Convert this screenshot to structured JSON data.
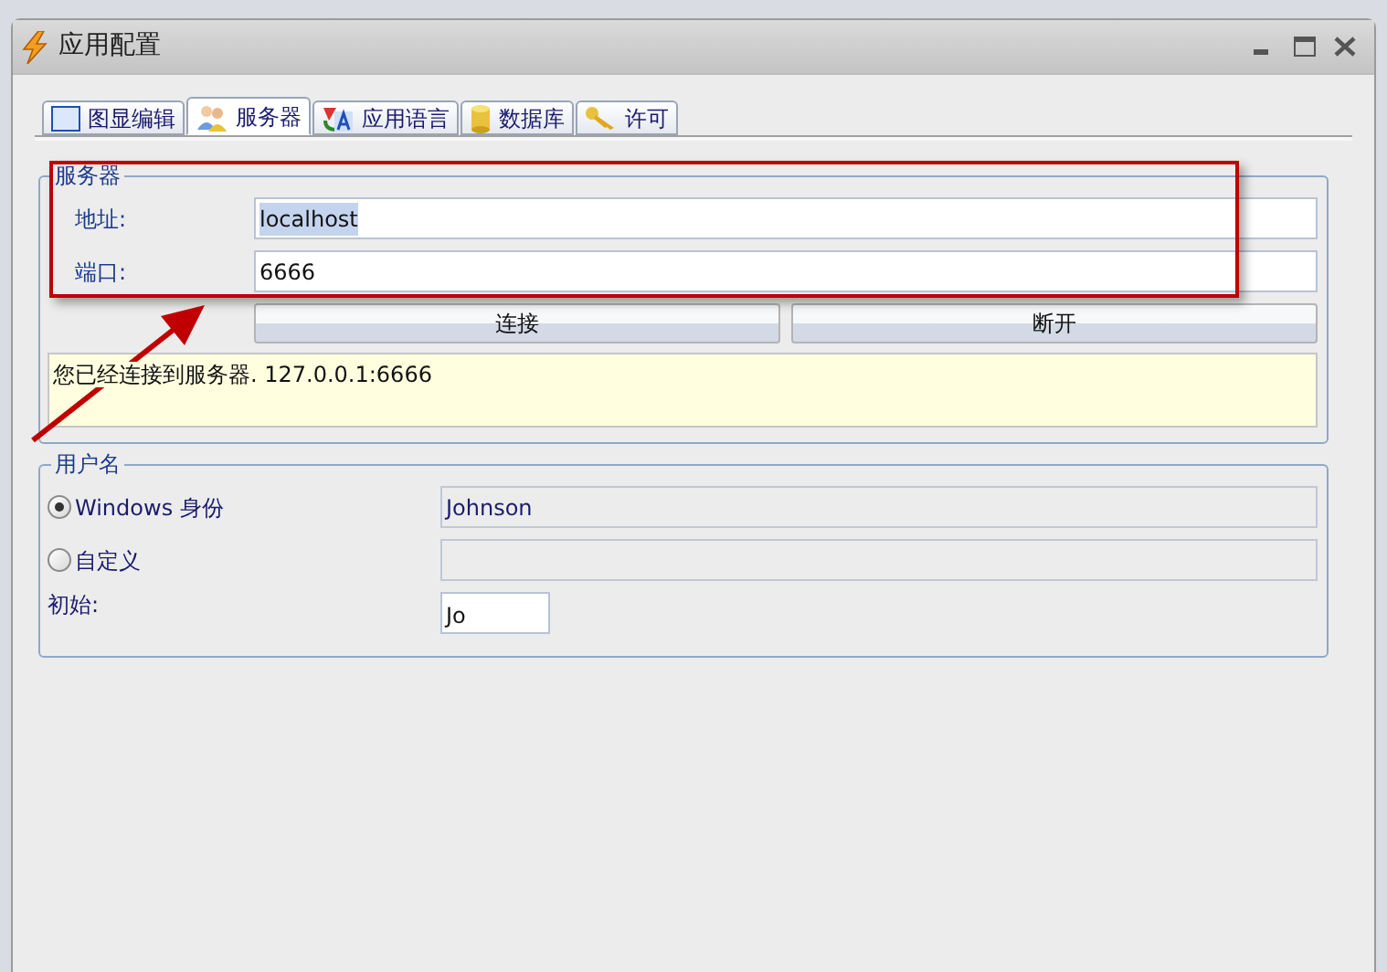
{
  "window": {
    "title": "应用配置"
  },
  "tabs": [
    {
      "label": "图显编辑",
      "selected": false,
      "kind": "frame"
    },
    {
      "label": "服务器",
      "selected": true,
      "kind": "users"
    },
    {
      "label": "应用语言",
      "selected": false,
      "kind": "language"
    },
    {
      "label": "数据库",
      "selected": false,
      "kind": "database"
    },
    {
      "label": "许可",
      "selected": false,
      "kind": "key"
    }
  ],
  "server": {
    "legend": "服务器",
    "fields": [
      {
        "label": "地址:",
        "value": "localhost",
        "highlighted": true
      },
      {
        "label": "端口:",
        "value": "6666",
        "highlighted": false
      }
    ],
    "buttons": [
      "连接",
      "断开"
    ],
    "message": "您已经连接到服务器. 127.0.0.1:6666"
  },
  "user": {
    "legend": "用户名",
    "options": [
      {
        "label": "Windows 身份",
        "selected": true,
        "value": "Johnson"
      },
      {
        "label": "自定义",
        "selected": false
      }
    ],
    "initial": {
      "label": "初始:",
      "value": "Jo"
    }
  },
  "annotation": {
    "highlight": true
  }
}
